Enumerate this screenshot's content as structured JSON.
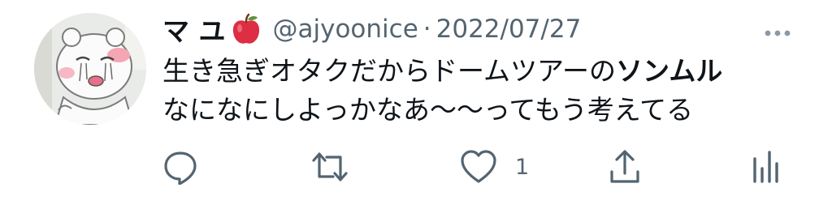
{
  "tweet": {
    "display_name": "マ ユ",
    "name_emoji": "apple-emoji",
    "handle": "@ajyoonice",
    "separator": "·",
    "date": "2022/07/27",
    "text_line1_prefix": "生き急ぎオタクだからドームツアーの",
    "text_line1_bold": "ソンムル",
    "text_line2": "なになにしよっかなあ〜〜ってもう考えてる"
  },
  "actions": {
    "reply_icon": "reply-icon",
    "retweet_icon": "retweet-icon",
    "like_icon": "heart-icon",
    "like_count": "1",
    "share_icon": "share-icon",
    "analytics_icon": "analytics-icon"
  },
  "colors": {
    "text": "#0f1419",
    "secondary": "#536471",
    "background": "#ffffff"
  }
}
